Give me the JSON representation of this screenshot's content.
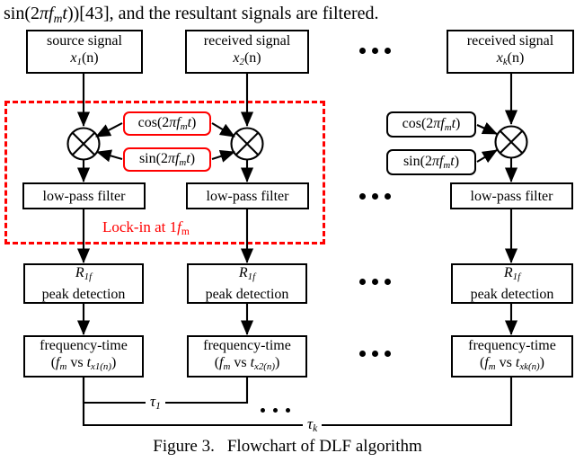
{
  "intro": {
    "text": "sin(2πfmt))[43], and the resultant signals are filtered.",
    "prefix": "sin(2",
    "pi": "π",
    "f": "f",
    "m_sub": "m",
    "t": "t",
    "suffix": "))[43], and the resultant signals are filtered."
  },
  "columns": [
    {
      "id": "col1",
      "source": {
        "line1": "source signal",
        "var": "x",
        "sub": "1",
        "arg": "(n)"
      },
      "lowpass": "low-pass filter",
      "peak": {
        "line1_sym": "R",
        "line1_sub": "1f",
        "line2": "peak detection"
      },
      "freqtime": {
        "line1": "frequency-time",
        "line2_open": "(",
        "f": "f",
        "fsub": "m",
        "vs": " vs ",
        "t": "t",
        "tsub": "x1(n)",
        "close": ")"
      }
    },
    {
      "id": "col2",
      "source": {
        "line1": "received signal",
        "var": "x",
        "sub": "2",
        "arg": "(n)"
      },
      "lowpass": "low-pass filter",
      "peak": {
        "line1_sym": "R",
        "line1_sub": "1f",
        "line2": "peak detection"
      },
      "freqtime": {
        "line1": "frequency-time",
        "line2_open": "(",
        "f": "f",
        "fsub": "m",
        "vs": " vs ",
        "t": "t",
        "tsub": "x2(n)",
        "close": ")"
      }
    },
    {
      "id": "colk",
      "source": {
        "line1": "received signal",
        "var": "x",
        "sub": "k",
        "arg": "(n)"
      },
      "lowpass": "low-pass filter",
      "peak": {
        "line1_sym": "R",
        "line1_sub": "1f",
        "line2": "peak detection"
      },
      "freqtime": {
        "line1": "frequency-time",
        "line2_open": "(",
        "f": "f",
        "fsub": "m",
        "vs": " vs ",
        "t": "t",
        "tsub": "xk(n)",
        "close": ")"
      }
    }
  ],
  "reference_signals": {
    "cos": {
      "prefix": "cos(2",
      "pi": "π",
      "f": "f",
      "fsub": "m",
      "t": "t",
      "close": ")"
    },
    "sin": {
      "prefix": "sin(2",
      "pi": "π",
      "f": "f",
      "fsub": "m",
      "t": "t",
      "close": ")"
    }
  },
  "lockin": {
    "label_prefix": "Lock-in at 1",
    "label_f": "f",
    "label_sub": "m",
    "color": "#ff0000"
  },
  "delays": {
    "tau1_sym": "τ",
    "tau1_sub": "1",
    "tauk_sym": "τ",
    "tauk_sub": "k"
  },
  "caption": {
    "label": "Figure 3.",
    "text": "Flowchart of DLF algorithm"
  },
  "colors": {
    "line": "#000000",
    "accent_red": "#ff0000",
    "background": "#ffffff"
  }
}
